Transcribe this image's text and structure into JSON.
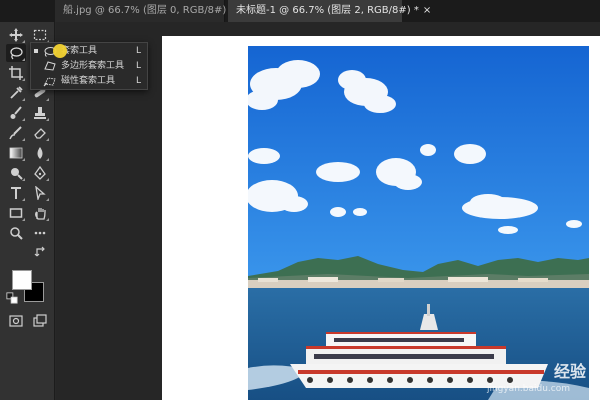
{
  "tabs": [
    {
      "label": "船.jpg @ 66.7% (图层 0, RGB/8#) *",
      "close": "×"
    },
    {
      "label": "未标题-1 @ 66.7% (图层 2, RGB/8#) *",
      "close": "×"
    }
  ],
  "toolbar": {
    "tools": [
      "move-tool",
      "marquee-tool",
      "lasso-tool",
      "crop-tool",
      "eyedropper-tool",
      "healing-tool",
      "brush-tool",
      "stamp-tool",
      "history-brush-tool",
      "eraser-tool",
      "gradient-tool",
      "blur-tool",
      "dodge-tool",
      "pen-tool",
      "type-tool",
      "path-selection-tool",
      "rectangle-tool",
      "hand-tool",
      "zoom-tool",
      "more-tools"
    ],
    "foreground_color": "#ffffff",
    "background_color": "#000000"
  },
  "flyout": {
    "items": [
      {
        "label": "套索工具",
        "shortcut": "L",
        "icon": "lasso-icon"
      },
      {
        "label": "多边形套索工具",
        "shortcut": "L",
        "icon": "polygonal-lasso-icon"
      },
      {
        "label": "磁性套索工具",
        "shortcut": "L",
        "icon": "magnetic-lasso-icon"
      }
    ]
  },
  "watermark": {
    "text": "经验",
    "sub": "jingyan.baidu.com"
  },
  "colors": {
    "sky_top": "#1a6fd8",
    "sea": "#1d5d95",
    "ship_hull": "#f4f4f4",
    "ship_stripe": "#c8392b"
  }
}
